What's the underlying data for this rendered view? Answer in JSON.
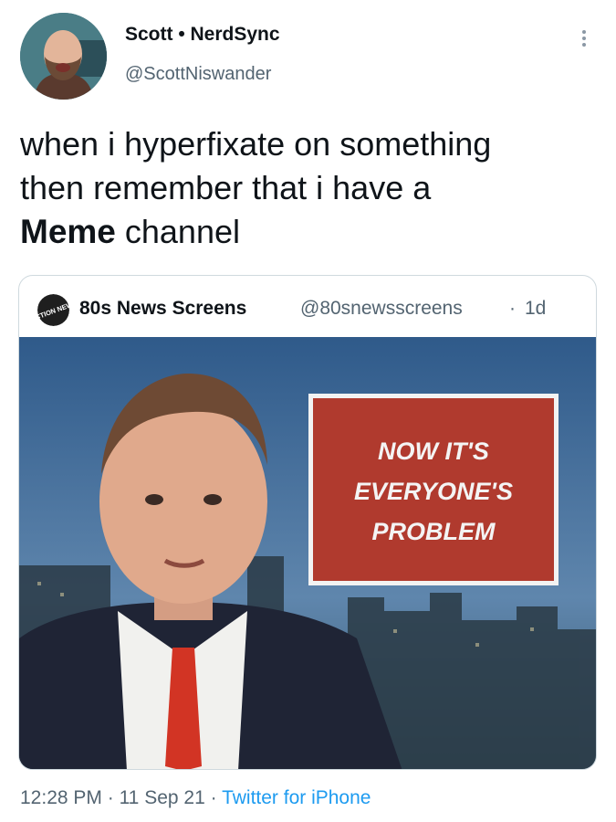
{
  "author": {
    "display_name": "Scott • NerdSync",
    "handle": "@ScottNiswander"
  },
  "tweet": {
    "line1": "when i hyperfixate on something",
    "line2": "then remember that i have a",
    "line3_bold": "Meme",
    "line3_rest": " channel"
  },
  "quoted": {
    "avatar_text": "ACTION NEWS",
    "display_name": "80s News Screens",
    "handle": "@80snewsscreens",
    "time": "1d",
    "image": {
      "card_line1": "NOW IT'S",
      "card_line2": "EVERYONE'S",
      "card_line3": "PROBLEM"
    }
  },
  "footer": {
    "time": "12:28 PM",
    "date": "11 Sep 21",
    "source": "Twitter for iPhone"
  },
  "colors": {
    "text": "#0f1419",
    "secondary": "#536471",
    "link": "#1d9bf0",
    "border": "#cfd9de"
  },
  "icons": {
    "more": "vertical-ellipsis-icon"
  }
}
